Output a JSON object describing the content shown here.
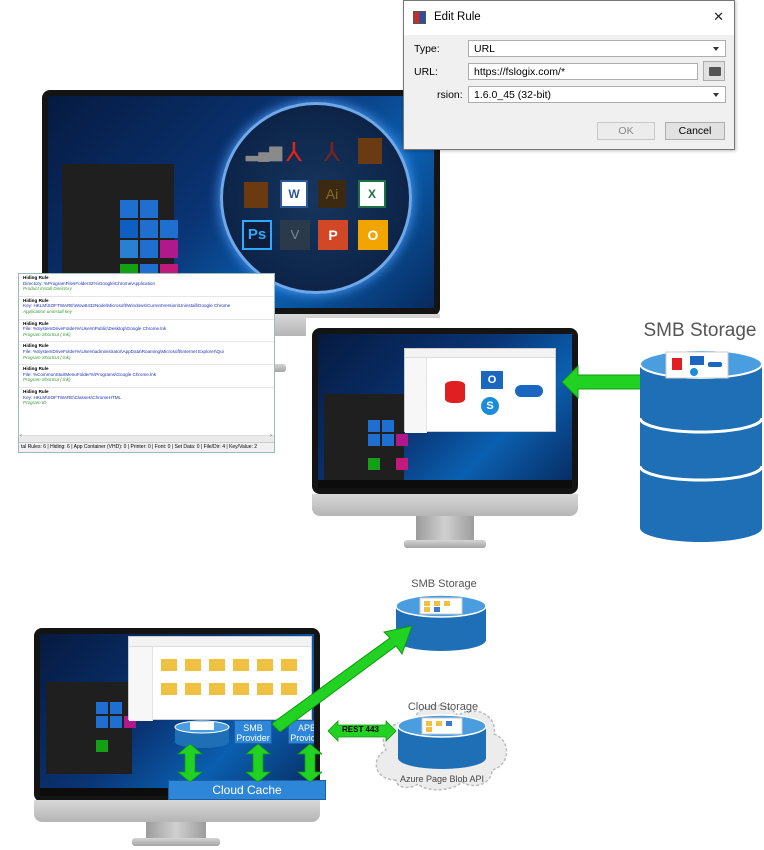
{
  "dialog": {
    "title": "Edit Rule",
    "type_label": "Type:",
    "type_value": "URL",
    "url_label": "URL:",
    "url_value": "https://fslogix.com/*",
    "version_label": "rsion:",
    "version_value": "1.6.0_45 (32-bit)",
    "ok_label": "OK",
    "cancel_label": "Cancel",
    "close_glyph": "✕"
  },
  "rules_list": {
    "items": [
      {
        "title": "Hiding Rule",
        "path": "Directory: %ProgramFilesFolder32%\\Google\\Chrome\\Application",
        "desc": "Product Install Directory"
      },
      {
        "title": "Hiding Rule",
        "path": "Key: HKLM\\SOFTWARE\\Wow6432Node\\Microsoft\\Windows\\CurrentVersion\\Uninstall\\Google Chrome",
        "desc": "Application uninstall key"
      },
      {
        "title": "Hiding Rule",
        "path": "File: %SystemDriveFolder%\\Users\\Public\\Desktop\\Google Chrome.lnk",
        "desc": "Program Shortcut (.lnk)"
      },
      {
        "title": "Hiding Rule",
        "path": "File: %SystemDriveFolder%\\Users\\administrator\\AppData\\Roaming\\Microsoft\\Internet Explorer\\Qui",
        "desc": "Program Shortcut (.lnk)"
      },
      {
        "title": "Hiding Rule",
        "path": "File: %CommonStartMenuFolder%\\Programs\\Google Chrome.lnk",
        "desc": "Program Shortcut (.lnk)"
      },
      {
        "title": "Hiding Rule",
        "path": "Key: HKLM\\SOFTWARE\\Classes\\ChromeHTML",
        "desc": "Program ID"
      }
    ],
    "status": "tal Rules: 6  |  Hiding: 6  |  App Container (VHD): 0  |  Printer: 0  |  Font: 0  |  Set Data: 0  |  File/Dir: 4  |  Key/Value: 2"
  },
  "middle": {
    "storage_label": "SMB Storage"
  },
  "bottom": {
    "smb_storage_label": "SMB Storage",
    "cloud_storage_label": "Cloud Storage",
    "azure_label": "Azure Page Blob API",
    "smb_provider": "SMB Provider",
    "apb_provider": "APB Provider",
    "rest_label": "REST 443",
    "cloud_cache_label": "Cloud Cache"
  },
  "colors": {
    "arrow_green": "#22d222",
    "storage_blue": "#1e6fb5",
    "box_blue": "#2e86d8"
  }
}
